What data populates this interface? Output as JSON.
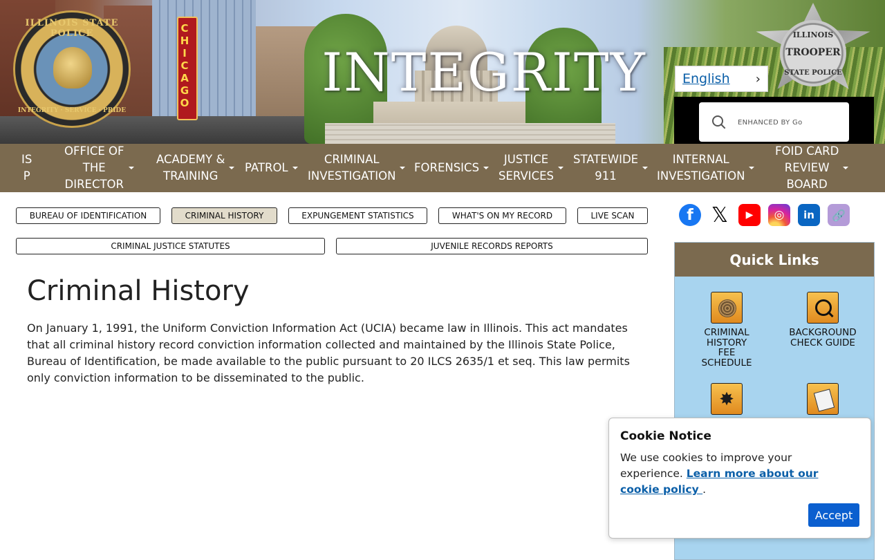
{
  "header": {
    "banner_text": "INTEGRITY",
    "seal": {
      "top_text": "ILLINOIS STATE POLICE",
      "bottom_text": "INTEGRITY · SERVICE · PRIDE"
    },
    "marquee_text": "CHICAGO",
    "badge": {
      "line1": "ILLINOIS",
      "line2": "TROOPER",
      "line3": "STATE POLICE"
    },
    "language": {
      "label": "English",
      "chevron": "›"
    },
    "search": {
      "placeholder": "ENHANCED BY Go"
    }
  },
  "nav": {
    "items": [
      {
        "label": "IS\nP",
        "dropdown": false
      },
      {
        "label": "OFFICE OF\nTHE\nDIRECTOR",
        "dropdown": true
      },
      {
        "label": "ACADEMY &\nTRAINING",
        "dropdown": true
      },
      {
        "label": "PATROL",
        "dropdown": true
      },
      {
        "label": "CRIMINAL\nINVESTIGATION",
        "dropdown": true
      },
      {
        "label": "FORENSICS",
        "dropdown": true
      },
      {
        "label": "JUSTICE\nSERVICES",
        "dropdown": true
      },
      {
        "label": "STATEWIDE\n911",
        "dropdown": true
      },
      {
        "label": "INTERNAL\nINVESTIGATION",
        "dropdown": true
      },
      {
        "label": "FOID CARD\nREVIEW\nBOARD",
        "dropdown": true
      }
    ]
  },
  "subtabs": [
    {
      "label": "BUREAU OF IDENTIFICATION",
      "active": false
    },
    {
      "label": "CRIMINAL HISTORY",
      "active": true
    },
    {
      "label": "EXPUNGEMENT STATISTICS",
      "active": false
    },
    {
      "label": "WHAT'S ON MY RECORD",
      "active": false
    },
    {
      "label": "LIVE SCAN",
      "active": false
    },
    {
      "label": "CRIMINAL JUSTICE STATUTES",
      "active": false
    },
    {
      "label": "JUVENILE RECORDS REPORTS",
      "active": false
    }
  ],
  "main": {
    "title": "Criminal History",
    "body": "On January 1, 1991, the Uniform Conviction Information Act (UCIA) became law in Illinois. This act mandates that all criminal history record conviction information collected and maintained by the Illinois State Police, Bureau of Identification, be made available to the public pursuant to 20 ILCS 2635/1 et seq. This law permits only conviction information to be disseminated to the public."
  },
  "social": {
    "facebook": "f",
    "x": "𝕏",
    "youtube": "▶",
    "instagram": "◎",
    "linkedin": "in",
    "link": "🔗"
  },
  "quick_links": {
    "title": "Quick Links",
    "items": [
      {
        "label": "CRIMINAL\nHISTORY\nFEE\nSCHEDULE",
        "icon": "fingerprint-icon"
      },
      {
        "label": "BACKGROUND\nCHECK GUIDE",
        "icon": "magnifier-check-icon"
      },
      {
        "label": "",
        "icon": "cannabis-leaf-icon",
        "glyph": "✸"
      },
      {
        "label": "",
        "icon": "document-icon"
      }
    ]
  },
  "cookie": {
    "title": "Cookie Notice",
    "text": "We use cookies to improve your experience.",
    "link_text": "Learn more about our cookie policy ",
    "after_link": ".",
    "accept_label": "Accept"
  },
  "colors": {
    "nav_bg": "#7b6a4f",
    "active_tab": "#e2dccb",
    "quick_links_bg": "#a8d4ef",
    "accept_button": "#0b5fcf",
    "link": "#0b5fa8"
  }
}
